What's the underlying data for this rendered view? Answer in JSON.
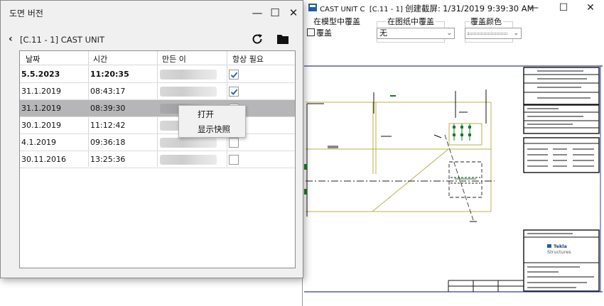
{
  "back_window": {
    "title_app": "CAST UNIT C",
    "title_mark": "[C.11 - 1]",
    "title_label": "创建截屏:",
    "title_datetime": "1/31/2019 9:39:30 AM",
    "controls": {
      "model_overlay_label": "在模型中覆盖",
      "overlay_checkbox_label": "覆盖",
      "drawing_overlay_label": "在图纸中覆盖",
      "drawing_overlay_value": "无",
      "overlay_color_label": "覆盖颜色"
    },
    "logo_line1": "Tekla",
    "logo_line2": "Structures"
  },
  "versions_window": {
    "title": "도면 버전",
    "breadcrumb": "[C.11 - 1] CAST UNIT",
    "columns": [
      "날짜",
      "시간",
      "만든 이",
      "항상 필요"
    ],
    "rows": [
      {
        "date": "5.5.2023",
        "time": "11:20:35",
        "always_required": true,
        "bold": true,
        "selected": false
      },
      {
        "date": "31.1.2019",
        "time": "08:43:17",
        "always_required": true,
        "bold": false,
        "selected": false
      },
      {
        "date": "31.1.2019",
        "time": "08:39:30",
        "always_required": false,
        "bold": false,
        "selected": true
      },
      {
        "date": "30.1.2019",
        "time": "11:12:42",
        "always_required": false,
        "bold": false,
        "selected": false
      },
      {
        "date": "4.1.2019",
        "time": "09:36:18",
        "always_required": false,
        "bold": false,
        "selected": false
      },
      {
        "date": "30.11.2016",
        "time": "13:25:36",
        "always_required": false,
        "bold": false,
        "selected": false
      }
    ],
    "context_menu": [
      "打开",
      "显示快照"
    ]
  },
  "colors": {
    "selected_row": "#b6b6b8",
    "check_mark": "#1e5fa8",
    "drawing_line": "#b8b34a",
    "frame_line": "#3a3aa0"
  },
  "icons": [
    "back-icon",
    "refresh-icon",
    "folder-icon",
    "minimize-icon",
    "maximize-icon",
    "close-icon",
    "checkmark-icon",
    "tekla-logo-icon"
  ]
}
